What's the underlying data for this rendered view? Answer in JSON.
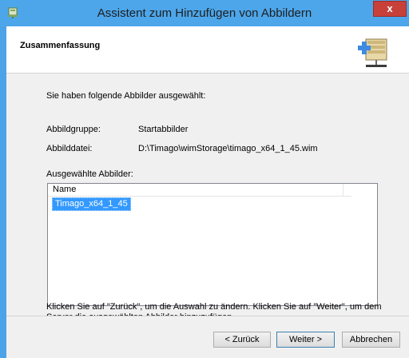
{
  "window": {
    "title": "Assistent zum Hinzufügen von Abbildern",
    "close_label": "x"
  },
  "header": {
    "title": "Zusammenfassung"
  },
  "summary": {
    "intro": "Sie haben folgende Abbilder ausgewählt:",
    "group_label": "Abbildgruppe:",
    "group_value": "Startabbilder",
    "file_label": "Abbilddatei:",
    "file_value": "D:\\Timago\\wimStorage\\timago_x64_1_45.wim",
    "selected_label": "Ausgewählte Abbilder:"
  },
  "listview": {
    "column_header": "Name",
    "items": [
      "Timago_x64_1_45"
    ]
  },
  "footer_text": "Klicken Sie auf \"Zurück\", um die Auswahl zu ändern. Klicken Sie auf \"Weiter\", um dem Server die ausgewählten Abbilder hinzuzufügen.",
  "buttons": {
    "back": "< Zurück",
    "next": "Weiter >",
    "cancel": "Abbrechen"
  },
  "colors": {
    "title_bar": "#4da6ea",
    "close_button": "#c7413a",
    "selection": "#3399ff",
    "content_bg": "#f0f0f0"
  },
  "icons": {
    "app": "wds-server-icon",
    "header": "add-image-server-icon"
  }
}
